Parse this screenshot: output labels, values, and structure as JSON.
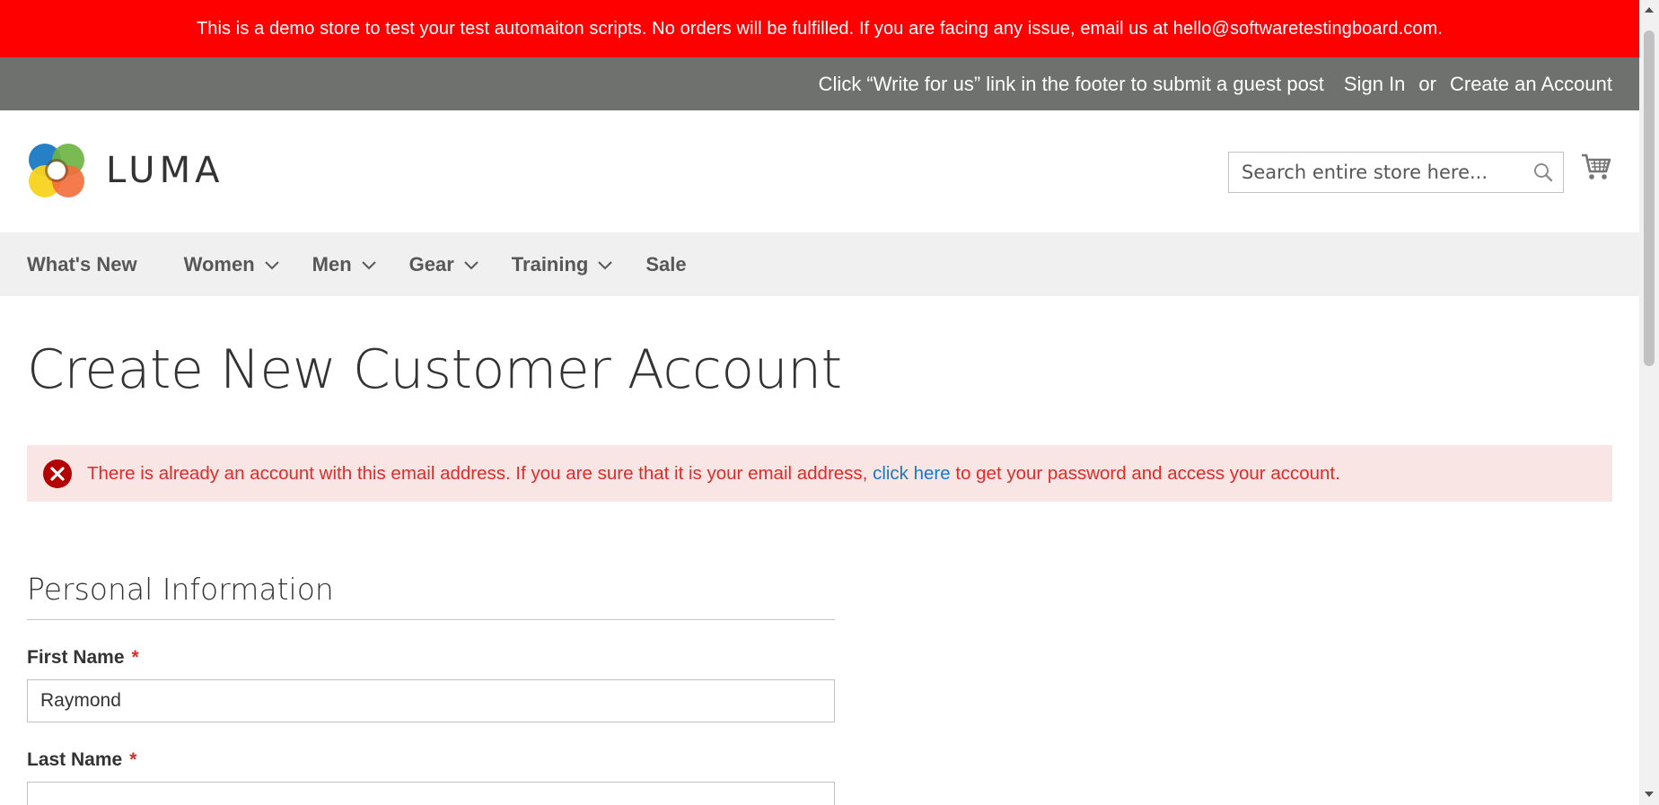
{
  "banner": {
    "text": "This is a demo store to test your test automaiton scripts. No orders will be fulfilled. If you are facing any issue, email us at hello@softwaretestingboard.com."
  },
  "top_links": {
    "guest_post": "Click “Write for us” link in the footer to submit a guest post",
    "sign_in": "Sign In",
    "or": "or",
    "create_account": "Create an Account"
  },
  "header": {
    "logo_text": "LUMA",
    "search_placeholder": "Search entire store here...",
    "search_icon": "search-icon",
    "cart_icon": "cart-icon"
  },
  "nav": {
    "items": [
      {
        "label": "What's New",
        "has_dropdown": false
      },
      {
        "label": "Women",
        "has_dropdown": true
      },
      {
        "label": "Men",
        "has_dropdown": true
      },
      {
        "label": "Gear",
        "has_dropdown": true
      },
      {
        "label": "Training",
        "has_dropdown": true
      },
      {
        "label": "Sale",
        "has_dropdown": false
      }
    ]
  },
  "main": {
    "title": "Create New Customer Account",
    "error": {
      "before": "There is already an account with this email address. If you are sure that it is your email address, ",
      "link": "click here",
      "after": " to get your password and access your account."
    },
    "section_title": "Personal Information",
    "fields": [
      {
        "label": "First Name",
        "required": "*",
        "value": "Raymond"
      },
      {
        "label": "Last Name",
        "required": "*",
        "value": ""
      }
    ]
  },
  "colors": {
    "banner_bg": "#ff0000",
    "top_bar_bg": "#6e716e",
    "nav_bg": "#f0f0f0",
    "error_bg": "#fae5e5",
    "error_text": "#e02b27",
    "link": "#1979c3"
  }
}
